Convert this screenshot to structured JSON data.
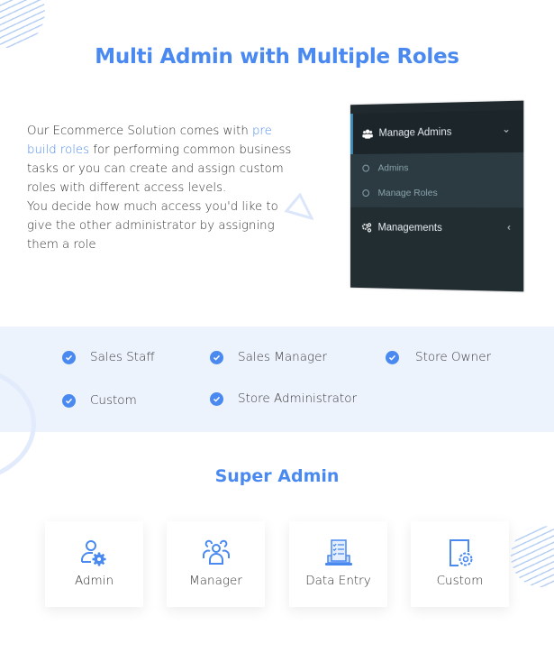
{
  "header": {
    "title": "Multi Admin with Multiple Roles"
  },
  "intro": {
    "text_before_link": "Our Ecommerce Solution comes with ",
    "link_text": "pre build roles",
    "text_after_link": " for performing common business tasks or you can create and assign custom roles with different access levels.",
    "second_paragraph": "You decide how much access you'd like to give the other administrator by assigning them a role"
  },
  "sidebar_mock": {
    "items": [
      {
        "label": "Manage Admins",
        "icon": "users-icon",
        "chevron": "chevron-down-icon",
        "expanded": true,
        "children": [
          {
            "label": "Admins"
          },
          {
            "label": "Manage Roles"
          }
        ]
      },
      {
        "label": "Managements",
        "icon": "cogs-icon",
        "chevron": "chevron-left-icon",
        "expanded": false
      }
    ]
  },
  "roles": [
    {
      "label": "Sales Staff"
    },
    {
      "label": "Sales Manager"
    },
    {
      "label": "Store Owner"
    },
    {
      "label": "Custom"
    },
    {
      "label": "Store Administrator"
    }
  ],
  "super_admin": {
    "title": "Super Admin",
    "cards": [
      {
        "label": "Admin",
        "icon": "user-gear-icon"
      },
      {
        "label": "Manager",
        "icon": "user-group-icon"
      },
      {
        "label": "Data Entry",
        "icon": "laptop-checklist-icon"
      },
      {
        "label": "Custom",
        "icon": "document-gear-icon"
      }
    ]
  },
  "colors": {
    "accent": "#4a8af0",
    "band_background": "#edf3fd",
    "sidebar_background": "#222d32",
    "sidebar_active_border": "#3c8dbc"
  }
}
